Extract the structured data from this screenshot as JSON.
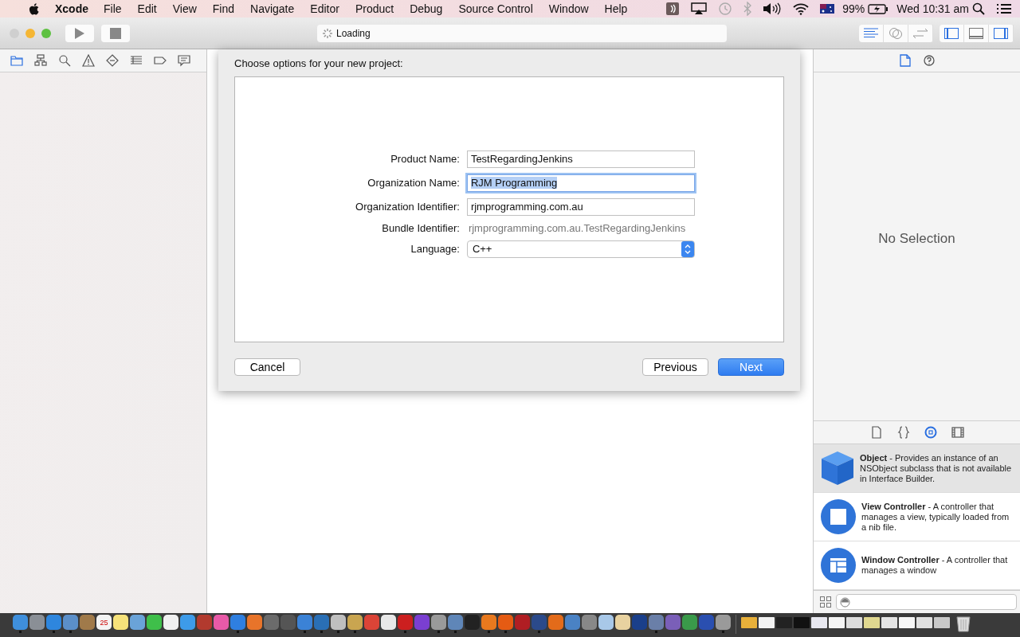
{
  "menu_bar": {
    "app": "Xcode",
    "menus": [
      "File",
      "Edit",
      "View",
      "Find",
      "Navigate",
      "Editor",
      "Product",
      "Debug",
      "Source Control",
      "Window",
      "Help"
    ],
    "battery": "99%",
    "clock": "Wed 10:31 am"
  },
  "toolbar": {
    "activity": "Loading"
  },
  "navigator_tabs": [
    {
      "kind": "folder",
      "selected": true
    },
    {
      "kind": "hierarchy",
      "selected": false
    },
    {
      "kind": "search",
      "selected": false
    },
    {
      "kind": "warning",
      "selected": false
    },
    {
      "kind": "diamond",
      "selected": false
    },
    {
      "kind": "list",
      "selected": false
    },
    {
      "kind": "tag",
      "selected": false
    },
    {
      "kind": "comment",
      "selected": false
    }
  ],
  "inspector_tabs": [
    {
      "kind": "file",
      "selected": true
    },
    {
      "kind": "help",
      "selected": false
    }
  ],
  "inspector": {
    "empty_text": "No Selection"
  },
  "dialog": {
    "title": "Choose options for your new project:",
    "fields": [
      {
        "kind": "text",
        "label": "Product Name:",
        "value": "TestRegardingJenkins",
        "focused": false
      },
      {
        "kind": "text",
        "label": "Organization Name:",
        "value": "RJM Programming",
        "focused": true
      },
      {
        "kind": "text",
        "label": "Organization Identifier:",
        "value": "rjmprogramming.com.au",
        "focused": false
      },
      {
        "kind": "static",
        "label": "Bundle Identifier:",
        "value": "rjmprogramming.com.au.TestRegardingJenkins"
      },
      {
        "kind": "popup",
        "label": "Language:",
        "value": "C++"
      }
    ],
    "buttons": [
      {
        "label": "Cancel",
        "kind": "secondary"
      },
      {
        "label": "Previous",
        "kind": "secondary"
      },
      {
        "label": "Next",
        "kind": "primary"
      }
    ]
  },
  "library_tabs": [
    {
      "kind": "file",
      "selected": false
    },
    {
      "kind": "braces",
      "selected": false
    },
    {
      "kind": "object",
      "selected": true
    },
    {
      "kind": "media",
      "selected": false
    }
  ],
  "library_items": [
    {
      "kind": "cube",
      "text": "**Object** - Provides an instance of an NSObject subclass that is not available in Interface Builder.",
      "selected": true
    },
    {
      "kind": "square",
      "text": "**View Controller** - A controller that manages a view, typically loaded from a nib file.",
      "selected": false
    },
    {
      "kind": "window",
      "text": "**Window Controller** - A controller that manages a window",
      "selected": false
    }
  ],
  "dock": [
    {
      "color": "#3f8fdc",
      "running": true
    },
    {
      "color": "#8a8f96",
      "running": false
    },
    {
      "color": "#2e86de",
      "running": true
    },
    {
      "color": "#5b8fc9",
      "running": true
    },
    {
      "color": "#a07a4a",
      "running": false
    },
    {
      "color": "#f4f4f4",
      "running": false,
      "label": "25"
    },
    {
      "color": "#f6e27a",
      "running": false
    },
    {
      "color": "#6aa3d8",
      "running": false
    },
    {
      "color": "#3fbf4a",
      "running": false
    },
    {
      "color": "#f0f0f0",
      "running": false
    },
    {
      "color": "#3d9be9",
      "running": false
    },
    {
      "color": "#b23a2e",
      "running": false
    },
    {
      "color": "#e85aa8",
      "running": false
    },
    {
      "color": "#2f7fe0",
      "running": true
    },
    {
      "color": "#e8742a",
      "running": false
    },
    {
      "color": "#6b6b6b",
      "running": false
    },
    {
      "color": "#555555",
      "running": false
    },
    {
      "color": "#3b82d6",
      "running": true
    },
    {
      "color": "#2a6fb5",
      "running": true
    },
    {
      "color": "#bfbfbf",
      "running": true
    },
    {
      "color": "#c9a550",
      "running": true
    },
    {
      "color": "#db4437",
      "running": false
    },
    {
      "color": "#e8e8e8",
      "running": false
    },
    {
      "color": "#cc1f1f",
      "running": true
    },
    {
      "color": "#7a3fd1",
      "running": false
    },
    {
      "color": "#9a9a9a",
      "running": true
    },
    {
      "color": "#5f86b8",
      "running": true
    },
    {
      "color": "#222222",
      "running": false
    },
    {
      "color": "#e8791e",
      "running": true
    },
    {
      "color": "#e55b13",
      "running": true
    },
    {
      "color": "#b01e23",
      "running": false
    },
    {
      "color": "#2b4a8a",
      "running": true
    },
    {
      "color": "#e36b1a",
      "running": false
    },
    {
      "color": "#4a82c4",
      "running": false
    },
    {
      "color": "#888888",
      "running": false
    },
    {
      "color": "#a8c8e8",
      "running": false
    },
    {
      "color": "#e8d2a0",
      "running": false
    },
    {
      "color": "#1a3f8a",
      "running": false
    },
    {
      "color": "#6a7fa8",
      "running": true
    },
    {
      "color": "#7a5fb8",
      "running": false
    },
    {
      "color": "#3a9a4a",
      "running": false
    },
    {
      "color": "#2a4fb0",
      "running": false
    },
    {
      "color": "#9a9a9a",
      "running": true
    }
  ],
  "dock_windows": [
    {
      "color": "#e8b03a"
    },
    {
      "color": "#f2f2f2"
    },
    {
      "color": "#222222"
    },
    {
      "color": "#111111"
    },
    {
      "color": "#e8e8f0"
    },
    {
      "color": "#f4f4f4"
    },
    {
      "color": "#dcdcdc"
    },
    {
      "color": "#e0d890"
    },
    {
      "color": "#e4e4e4"
    },
    {
      "color": "#f6f6f6"
    },
    {
      "color": "#e0e0e0"
    },
    {
      "color": "#c8c8c8"
    }
  ]
}
